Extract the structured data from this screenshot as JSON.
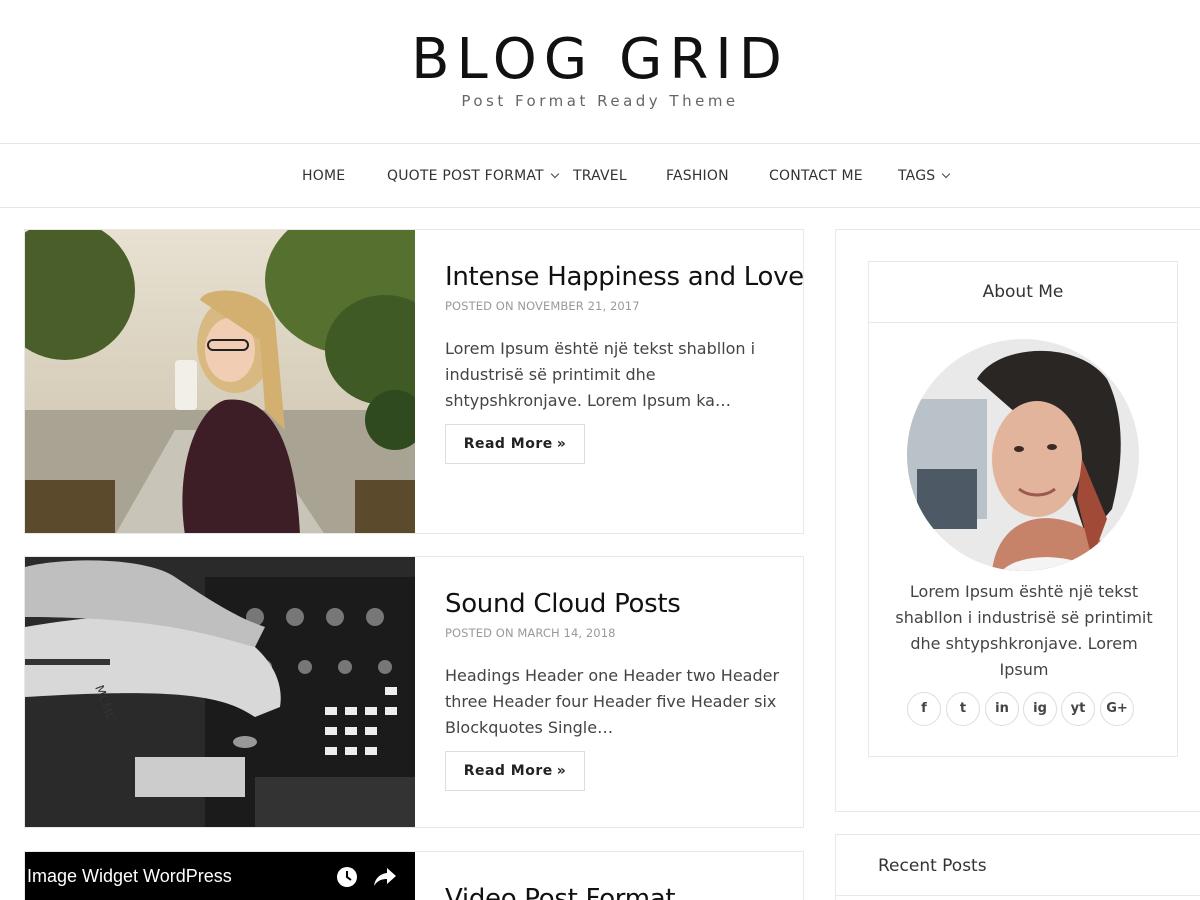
{
  "site": {
    "title": "BLOG GRID",
    "tagline": "Post Format Ready Theme"
  },
  "nav": {
    "items": [
      {
        "label": "HOME"
      },
      {
        "label": "QUOTE POST FORMAT"
      },
      {
        "label": "TRAVEL"
      },
      {
        "label": "FASHION"
      },
      {
        "label": "CONTACT ME"
      },
      {
        "label": "TAGS"
      }
    ]
  },
  "posts": [
    {
      "title": "Intense Happiness and Love",
      "meta": "POSTED ON NOVEMBER 21, 2017",
      "excerpt": "Lorem Ipsum është një tekst shabllon i industrisë së printimit dhe shtypshkronjave. Lorem Ipsum ka…",
      "read_more": "Read More"
    },
    {
      "title": "Sound Cloud Posts",
      "meta": "POSTED ON MARCH 14, 2018",
      "excerpt": "Headings Header one Header two Header three Header four Header five Header six Blockquotes Single…",
      "read_more": "Read More"
    },
    {
      "title": "Video Post Format",
      "video_title": "Image Widget WordPress"
    }
  ],
  "sidebar": {
    "about": {
      "title": "About Me",
      "text": "Lorem Ipsum është një tekst shabllon i industrisë së printimit dhe shtypshkronjave. Lorem Ipsum",
      "social": [
        "f",
        "t",
        "in",
        "ig",
        "yt",
        "G+"
      ]
    },
    "recent": {
      "title": "Recent Posts"
    }
  },
  "icons": {
    "social": [
      "facebook-icon",
      "twitter-icon",
      "linkedin-icon",
      "instagram-icon",
      "youtube-icon",
      "google-plus-icon"
    ]
  }
}
